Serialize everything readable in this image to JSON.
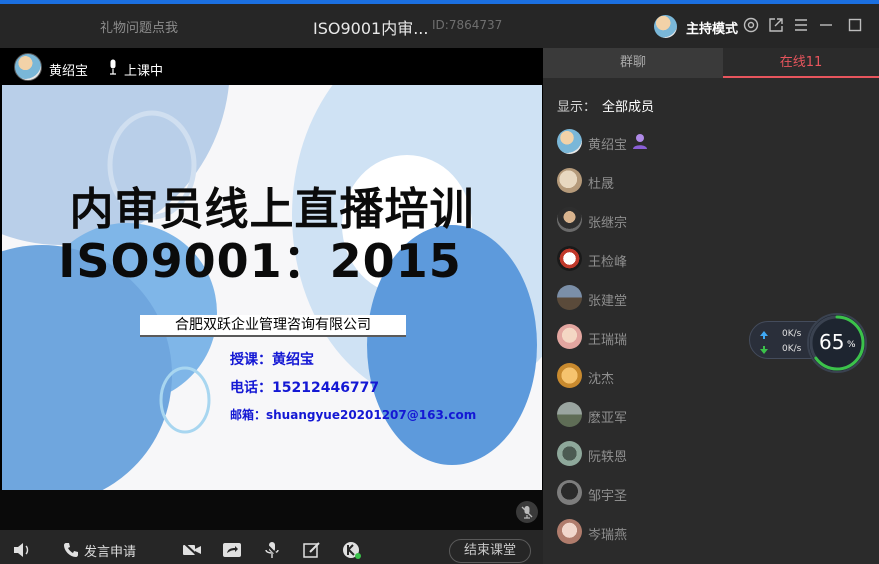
{
  "titlebar": {
    "gift_prompt": "礼物问题点我",
    "title": "ISO9001内审...",
    "room_id": "ID:7864737",
    "mode": "主持模式"
  },
  "video": {
    "presenter": "黄绍宝",
    "status": "上课中"
  },
  "slide": {
    "title_line1": "内审员线上直播培训",
    "title_line2": "ISO9001：2015",
    "company": "合肥双跃企业管理咨询有限公司",
    "teacher": "授课：黄绍宝",
    "phone": "电话：15212446777",
    "email": "邮箱：shuangyue20201207@163.com"
  },
  "toolbar": {
    "speak_request": "发言申请",
    "end_class": "结束课堂"
  },
  "panel": {
    "tab_chat": "群聊",
    "tab_online": "在线11",
    "filter_label": "显示：",
    "filter_value": "全部成员",
    "members": [
      {
        "name": "黄绍宝"
      },
      {
        "name": "杜晟"
      },
      {
        "name": "张继宗"
      },
      {
        "name": "王检峰"
      },
      {
        "name": "张建堂"
      },
      {
        "name": "王瑞瑞"
      },
      {
        "name": "沈杰"
      },
      {
        "name": "麽亚军"
      },
      {
        "name": "阮轶恩"
      },
      {
        "name": "邹宇圣"
      },
      {
        "name": "岑瑞燕"
      }
    ]
  },
  "network": {
    "upload": "0K/s",
    "download": "0K/s",
    "quality_value": "65",
    "quality_unit": "%",
    "quality_fraction": 0.65
  },
  "colors": {
    "accent": "#1b6fe0",
    "online_tab": "#e8555d",
    "slide_text_blue": "#1418d4"
  }
}
